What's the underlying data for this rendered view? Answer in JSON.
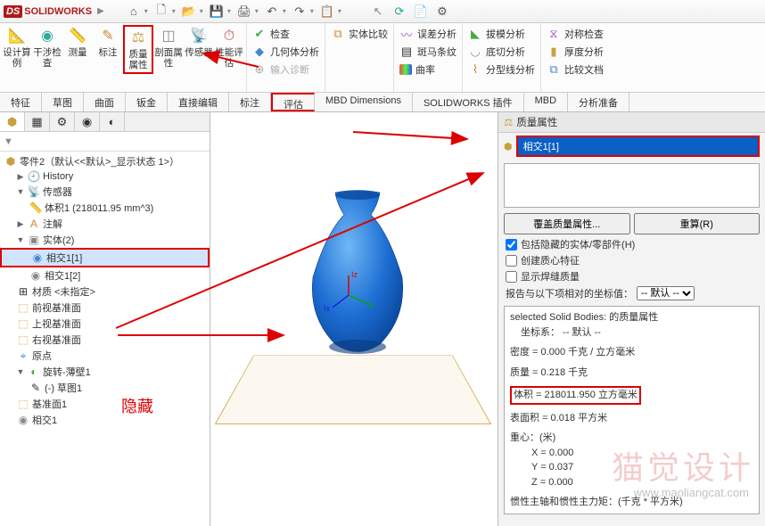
{
  "app": {
    "name": "SOLIDWORKS"
  },
  "titlebar_icons": [
    "⌂",
    "✚",
    "📁",
    "💾",
    "🖨",
    "⟲",
    "⟳",
    "⚙",
    "↖",
    "❓",
    "📋",
    "🔍"
  ],
  "ribbon": {
    "design_instance": "设计算例",
    "interference": "干涉检查",
    "measure": "测量",
    "markup": "标注",
    "mass_props": "质量属性",
    "section_props": "剖面属性",
    "sensor": "传感器",
    "perf_eval": "性能评估",
    "check": "检查",
    "geo_analysis": "几何体分析",
    "input_diag": "输入诊断",
    "body_compare": "实体比较",
    "deviation": "误差分析",
    "zebra": "斑马条纹",
    "curvature": "曲率",
    "draft": "拔模分析",
    "undercut": "底切分析",
    "parting": "分型线分析",
    "sym_check": "对称检查",
    "thickness": "厚度分析",
    "compare_doc": "比较文档"
  },
  "tabs": [
    "特征",
    "草图",
    "曲面",
    "钣金",
    "直接编辑",
    "标注",
    "评估",
    "MBD Dimensions",
    "SOLIDWORKS 插件",
    "MBD",
    "分析准备"
  ],
  "active_tab": 6,
  "tree": {
    "root": "零件2（默认<<默认>_显示状态 1>）",
    "history": "History",
    "sensors": "传感器",
    "sensor_item": "体积1 (218011.95 mm^3)",
    "annotations": "注解",
    "bodies": "实体(2)",
    "body1": "相交1[1]",
    "body2": "相交1[2]",
    "material": "材质 <未指定>",
    "front": "前视基准面",
    "top": "上视基准面",
    "right": "右视基准面",
    "origin": "原点",
    "revolve": "旋转-薄壁1",
    "sketch": "(-) 草图1",
    "plane1": "基准面1",
    "intersect": "相交1"
  },
  "annotation_hide": "隐藏",
  "right": {
    "title": "质量属性",
    "selection": "相交1[1]",
    "override": "覆盖质量属性...",
    "recalc": "重算(R)",
    "chk_hidden": "包括隐藏的实体/零部件(H)",
    "chk_com": "创建质心特征",
    "chk_weld": "显示焊缝质量",
    "coord_label": "报告与以下项相对的坐标值：",
    "coord_value": "-- 默认 --",
    "res_header": "selected Solid Bodies: 的质量属性",
    "res_coord": "坐标系：  -- 默认 --",
    "density": "密度 = 0.000 千克 / 立方毫米",
    "mass": "质量 = 0.218 千克",
    "volume": "体积 = 218011.950 立方毫米",
    "area": "表面积 = 0.018 平方米",
    "centroid": "重心：(米)",
    "cx": "X = 0.000",
    "cy": "Y = 0.037",
    "cz": "Z = 0.000",
    "inertia": "惯性主轴和惯性主力矩：(千克 * 平方米)"
  },
  "watermark": "猫觉设计",
  "watermark_url": "www.maoliangcat.com"
}
